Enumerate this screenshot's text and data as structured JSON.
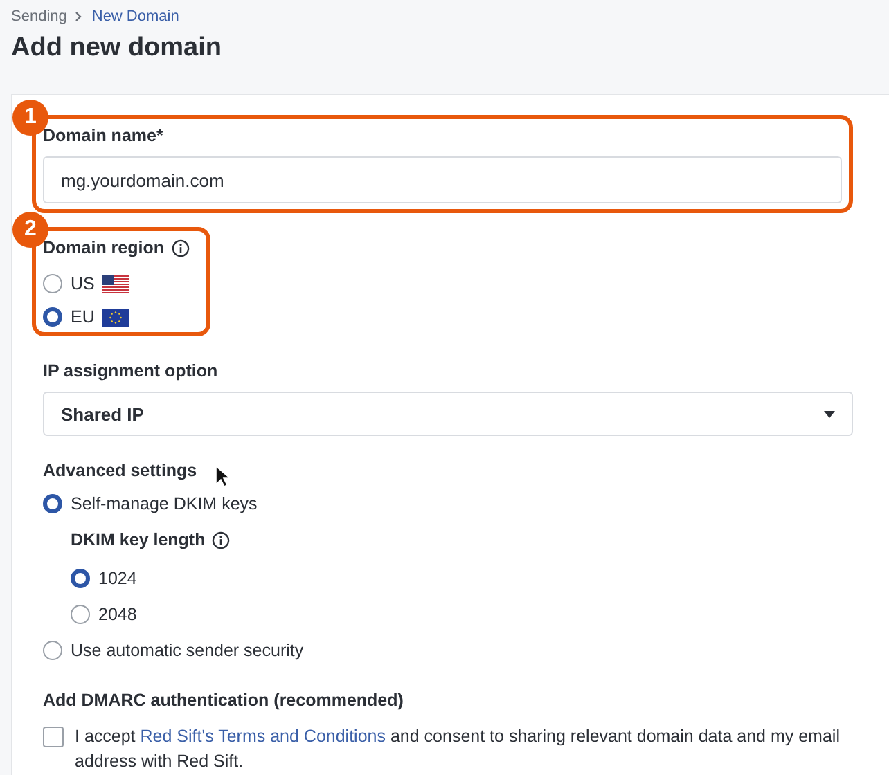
{
  "breadcrumb": [
    {
      "label": "Sending",
      "current": false
    },
    {
      "label": "New Domain",
      "current": true
    }
  ],
  "title": "Add new domain",
  "domain_name": {
    "label": "Domain name*",
    "value": "mg.yourdomain.com",
    "annotation": "1"
  },
  "domain_region": {
    "label": "Domain region",
    "annotation": "2",
    "options": [
      {
        "label": "US",
        "kind": "us",
        "selected": false
      },
      {
        "label": "EU",
        "kind": "eu",
        "selected": true
      }
    ]
  },
  "ip_assignment": {
    "label": "IP assignment option",
    "value": "Shared IP"
  },
  "advanced_settings": {
    "label": "Advanced settings",
    "options": [
      {
        "label": "Self-manage DKIM keys",
        "selected": true,
        "dkim": {
          "label": "DKIM key length",
          "options": [
            {
              "label": "1024",
              "selected": true
            },
            {
              "label": "2048",
              "selected": false
            }
          ]
        }
      },
      {
        "label": "Use automatic sender security",
        "selected": false
      }
    ]
  },
  "dmarc": {
    "label": "Add DMARC authentication (recommended)",
    "checked": false,
    "text_before": "I accept ",
    "link": "Red Sift's Terms and Conditions",
    "text_after": " and consent to sharing relevant domain data and my email address with Red Sift."
  }
}
